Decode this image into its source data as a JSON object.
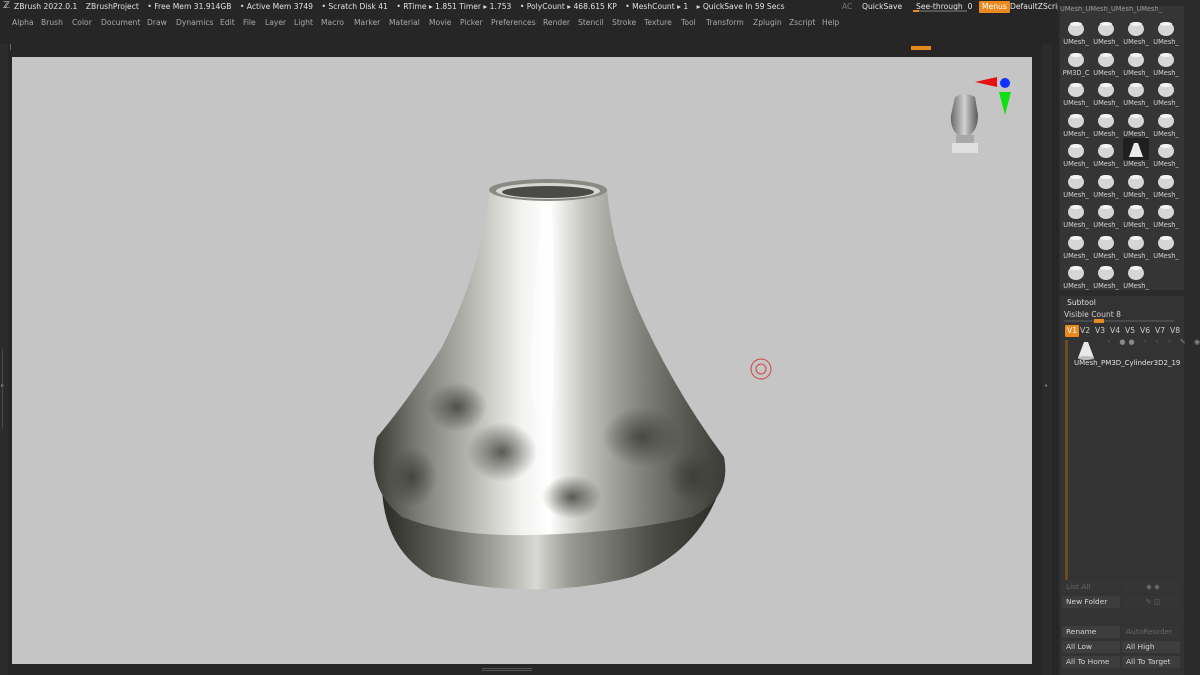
{
  "titlebar": {
    "app": "ZBrush 2022.0.1",
    "project": "ZBrushProject",
    "free_mem": "• Free Mem 31.914GB",
    "active_mem": "• Active Mem 3749",
    "scratch": "• Scratch Disk 41",
    "rtime": "• RTime ▸ 1.851 Timer ▸ 1.753",
    "polycount": "• PolyCount ▸ 468.615 KP",
    "meshcount": "• MeshCount ▸ 1",
    "quicksave_in": "▸ QuickSave In 59 Secs",
    "ac": "AC",
    "quicksave": "QuickSave",
    "see_through": "See-through",
    "see_through_value": "0",
    "menus": "Menus",
    "default_zscript": "DefaultZScript",
    "window_controls": "◂ ▸ ▬ ▭ ✕"
  },
  "menubar": [
    "Alpha",
    "Brush",
    "Color",
    "Document",
    "Draw",
    "Dynamics",
    "Edit",
    "File",
    "Layer",
    "Light",
    "Macro",
    "Marker",
    "Material",
    "Movie",
    "Picker",
    "Preferences",
    "Render",
    "Stencil",
    "Stroke",
    "Texture",
    "Tool",
    "Transform",
    "Zplugin",
    "Zscript",
    "Help"
  ],
  "brush_grid": {
    "top_peek": "UMesh_UMesh_UMesh_UMesh_",
    "rows": [
      [
        "UMesh_",
        "UMesh_",
        "UMesh_",
        "UMesh_"
      ],
      [
        "PM3D_C",
        "UMesh_",
        "UMesh_",
        "UMesh_"
      ],
      [
        "UMesh_",
        "UMesh_",
        "UMesh_",
        "UMesh_"
      ],
      [
        "UMesh_",
        "UMesh_",
        "UMesh_",
        "UMesh_"
      ],
      [
        "UMesh_",
        "UMesh_",
        "UMesh_",
        "UMesh_"
      ],
      [
        "UMesh_",
        "UMesh_",
        "UMesh_",
        "UMesh_"
      ],
      [
        "UMesh_",
        "UMesh_",
        "UMesh_",
        "UMesh_"
      ],
      [
        "UMesh_",
        "UMesh_",
        "UMesh_",
        "UMesh_"
      ],
      [
        "UMesh_",
        "UMesh_",
        "UMesh_"
      ]
    ],
    "selected": [
      4,
      2
    ]
  },
  "subtool": {
    "header": "Subtool",
    "visible_count": "Visible Count 8",
    "versions": [
      "V1",
      "V2",
      "V3",
      "V4",
      "V5",
      "V6",
      "V7",
      "V8"
    ],
    "active_version": "V1",
    "item_name": "UMesh_PM3D_Cylinder3D2_19",
    "item_icons": "◦ ●● ◦ ◦ ◦ ✎ ◉",
    "list_all": "List All",
    "list_all_icons": "◆ ◆",
    "new_folder": "New Folder",
    "new_folder_icons": "✎ ◫",
    "rename": "Rename",
    "auto_reorder": "AutoReorder",
    "all_low": "All Low",
    "all_high": "All High",
    "all_to_home": "All To Home",
    "all_to_target": "All To Target"
  },
  "colors": {
    "accent": "#e88a1f",
    "viewport_bg": "#c5c5c5",
    "ui_bg": "#262626"
  }
}
